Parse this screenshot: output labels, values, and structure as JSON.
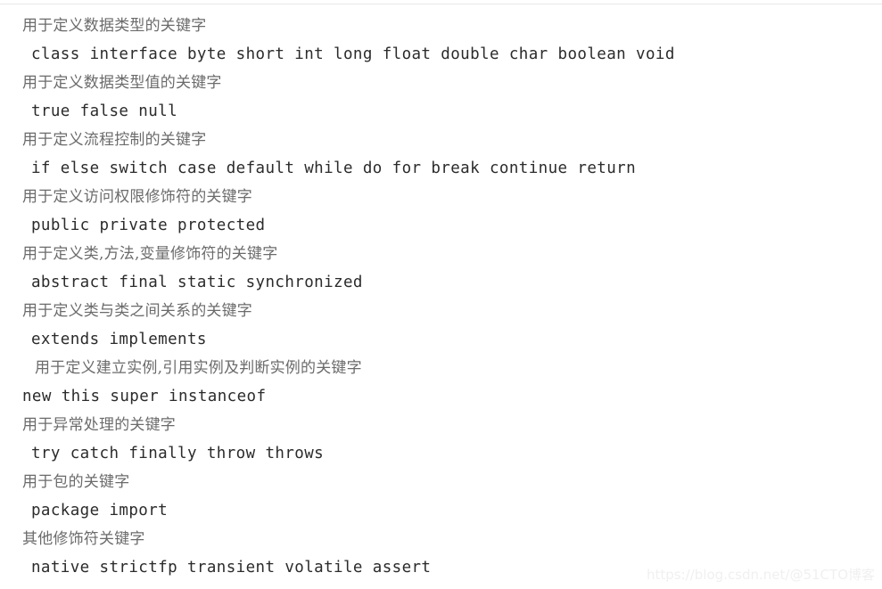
{
  "page": {
    "background_color": "#ffffff",
    "heading_color": "#6b6b6b",
    "keyword_color": "#2b2b2b",
    "rule_color": "#e8e8e8",
    "watermark_color": "#f0f0f0"
  },
  "watermark": {
    "text": "https://blog.csdn.net/@51CTO博客"
  },
  "sections": [
    {
      "heading": "用于定义数据类型的关键字",
      "keywords": "class interface byte short int long float double char boolean void",
      "heading_indented": false,
      "keywords_flush": false
    },
    {
      "heading": "用于定义数据类型值的关键字",
      "keywords": "true false null",
      "heading_indented": false,
      "keywords_flush": false
    },
    {
      "heading": "用于定义流程控制的关键字",
      "keywords": "if else switch case default while do for break continue return",
      "heading_indented": false,
      "keywords_flush": false
    },
    {
      "heading": "用于定义访问权限修饰符的关键字",
      "keywords": "public private protected",
      "heading_indented": false,
      "keywords_flush": false
    },
    {
      "heading": "用于定义类,方法,变量修饰符的关键字",
      "keywords": "abstract final static synchronized",
      "heading_indented": false,
      "keywords_flush": false
    },
    {
      "heading": "用于定义类与类之间关系的关键字",
      "keywords": "extends implements",
      "heading_indented": false,
      "keywords_flush": false
    },
    {
      "heading": "用于定义建立实例,引用实例及判断实例的关键字",
      "keywords": "new this super instanceof",
      "heading_indented": true,
      "keywords_flush": true
    },
    {
      "heading": "用于异常处理的关键字",
      "keywords": "try catch finally throw throws",
      "heading_indented": false,
      "keywords_flush": false
    },
    {
      "heading": "用于包的关键字",
      "keywords": "package import",
      "heading_indented": false,
      "keywords_flush": false
    },
    {
      "heading": "其他修饰符关键字",
      "keywords": "native strictfp transient volatile assert",
      "heading_indented": false,
      "keywords_flush": false
    }
  ]
}
